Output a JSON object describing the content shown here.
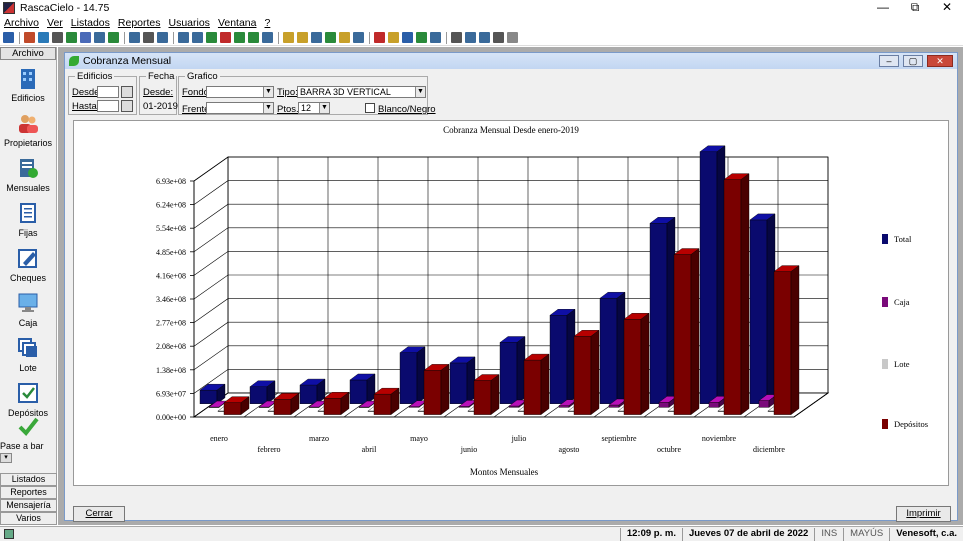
{
  "window": {
    "title": "RascaCielo - 14.75",
    "min": "—",
    "max": "⧉",
    "close": "✕"
  },
  "menu": [
    "Archivo",
    "Ver",
    "Listados",
    "Reportes",
    "Usuarios",
    "Ventana",
    "?"
  ],
  "sidebar": {
    "header": "Archivo",
    "items": [
      {
        "label": "Edificios",
        "icon": "building-icon"
      },
      {
        "label": "Propietarios",
        "icon": "people-icon"
      },
      {
        "label": "Mensuales",
        "icon": "monthly-doc-icon"
      },
      {
        "label": "Fijas",
        "icon": "document-icon"
      },
      {
        "label": "Cheques",
        "icon": "pencil-icon"
      },
      {
        "label": "Caja",
        "icon": "monitor-icon"
      },
      {
        "label": "Lote",
        "icon": "stack-icon"
      },
      {
        "label": "Depósitos",
        "icon": "checkbox-icon"
      },
      {
        "label": "Pase a bar",
        "icon": "check-icon"
      }
    ],
    "bottom": [
      "Listados",
      "Reportes",
      "Mensajería",
      "Varios"
    ]
  },
  "child": {
    "title": "Cobranza Mensual",
    "edificios": {
      "legend": "Edificios",
      "desde": "Desde:",
      "hasta": "Hasta:"
    },
    "fecha": {
      "legend": "Fecha",
      "desde": "Desde:",
      "value": "01-2019"
    },
    "grafico": {
      "legend": "Grafico",
      "fondo": "Fondo:",
      "frente": "Frente:",
      "tipo": "Tipo:",
      "tipo_value": "BARRA 3D VERTICAL",
      "ptos": "Ptos.:",
      "ptos_value": "12",
      "bn": "Blanco/Negro"
    },
    "close_btn": "Cerrar",
    "print_btn": "Imprimir"
  },
  "chart_data": {
    "type": "bar",
    "title": "Cobranza Mensual Desde enero-2019",
    "xlabel": "Montos Mensuales",
    "ylabel": "",
    "ylim": [
      0,
      693000000
    ],
    "yticks": [
      "0.00e+00",
      "6.93e+07",
      "1.38e+08",
      "2.08e+08",
      "2.77e+08",
      "3.46e+08",
      "4.16e+08",
      "4.85e+08",
      "5.54e+08",
      "6.24e+08",
      "6.93e+08"
    ],
    "categories": [
      "enero",
      "febrero",
      "marzo",
      "abril",
      "mayo",
      "junio",
      "julio",
      "agosto",
      "septiembre",
      "octubre",
      "noviembre",
      "diciembre"
    ],
    "legend_placement": "right",
    "series": [
      {
        "name": "Total",
        "color": "#0a0a6e",
        "values": [
          40000000,
          50000000,
          55000000,
          70000000,
          150000000,
          120000000,
          180000000,
          260000000,
          310000000,
          530000000,
          740000000,
          540000000
        ]
      },
      {
        "name": "Caja",
        "color": "#7a0a7a",
        "values": [
          1000000,
          1000000,
          1000000,
          1000000,
          2000000,
          3000000,
          4000000,
          5000000,
          7000000,
          15000000,
          15000000,
          20000000
        ]
      },
      {
        "name": "Lote",
        "color": "#c8c8c8",
        "values": [
          0,
          0,
          0,
          0,
          0,
          0,
          0,
          0,
          0,
          0,
          0,
          0
        ]
      },
      {
        "name": "Depósitos",
        "color": "#7a0000",
        "values": [
          35000000,
          45000000,
          48000000,
          60000000,
          130000000,
          100000000,
          160000000,
          230000000,
          280000000,
          470000000,
          690000000,
          420000000
        ]
      }
    ]
  },
  "status": {
    "time": "12:09 p. m.",
    "date": "Jueves 07 de abril de 2022",
    "ins": "INS",
    "mayus": "MAYÚS",
    "company": "Venesoft, c.a."
  },
  "toolbar_colors": [
    "#2a5ea8",
    "#c04a2a",
    "#2a7ab8",
    "#555",
    "#2a8a3a",
    "#4a6ab8",
    "#3a6a9a",
    "#2a8a3a",
    "#3a6a9a",
    "#555",
    "#3a6a9a",
    "#3a6a9a",
    "#3a6a9a",
    "#2a8a3a",
    "#c02a2a",
    "#2a8a3a",
    "#2a8a3a",
    "#3a6a9a",
    "#c8a02a",
    "#c8a02a",
    "#3a6a9a",
    "#2a8a3a",
    "#c8a02a",
    "#3a6a9a",
    "#c02a2a",
    "#c8a02a",
    "#2a5ea8",
    "#2a8a3a",
    "#3a6a9a",
    "#555",
    "#3a6a9a",
    "#3a6a9a",
    "#555",
    "#888"
  ]
}
